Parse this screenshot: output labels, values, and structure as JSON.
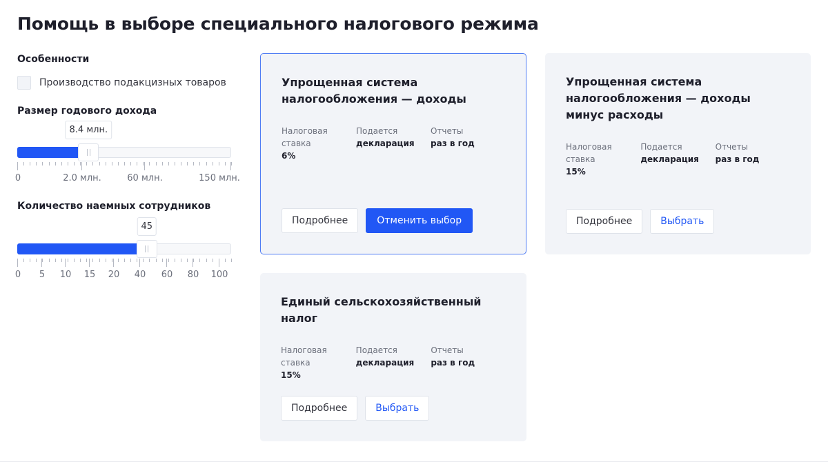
{
  "page": {
    "title": "Помощь в выборе специального налогового режима"
  },
  "filters": {
    "features": {
      "label": "Особенности",
      "checkbox": {
        "label": "Производство подакцизных товаров",
        "checked": false
      }
    },
    "income": {
      "label": "Размер годового дохода",
      "value_label": "8.4 млн.",
      "value_fraction": 0.33,
      "scale": [
        "0",
        "2.0 млн.",
        "60 млн.",
        "150 млн."
      ]
    },
    "employees": {
      "label": "Количество наемных сотрудников",
      "value_label": "45",
      "value": 45,
      "scale": [
        "0",
        "5",
        "10",
        "15",
        "20",
        "40",
        "60",
        "80",
        "100"
      ]
    }
  },
  "cards": [
    {
      "title": "Упрощенная система налогообложения — доходы",
      "selected": true,
      "props": [
        {
          "key": "Налоговая ставка",
          "value": "6%"
        },
        {
          "key": "Подается",
          "value": "декларация"
        },
        {
          "key": "Отчеты",
          "value": "раз в год"
        }
      ],
      "buttons": {
        "more": "Подробнее",
        "action": "Отменить выбор"
      }
    },
    {
      "title": "Упрощенная система налогообложения — доходы минус расходы",
      "selected": false,
      "props": [
        {
          "key": "Налоговая ставка",
          "value": "15%"
        },
        {
          "key": "Подается",
          "value": "декларация"
        },
        {
          "key": "Отчеты",
          "value": "раз в год"
        }
      ],
      "buttons": {
        "more": "Подробнее",
        "action": "Выбрать"
      }
    },
    {
      "title": "Единый сельскохозяйственный налог",
      "selected": false,
      "props": [
        {
          "key": "Налоговая ставка",
          "value": "15%"
        },
        {
          "key": "Подается",
          "value": "декларация"
        },
        {
          "key": "Отчеты",
          "value": "раз в год"
        }
      ],
      "buttons": {
        "more": "Подробнее",
        "action": "Выбрать"
      }
    }
  ],
  "colors": {
    "accent": "#2157f5",
    "card_bg": "#f2f4f8",
    "selected_border": "#4f7cf4"
  }
}
